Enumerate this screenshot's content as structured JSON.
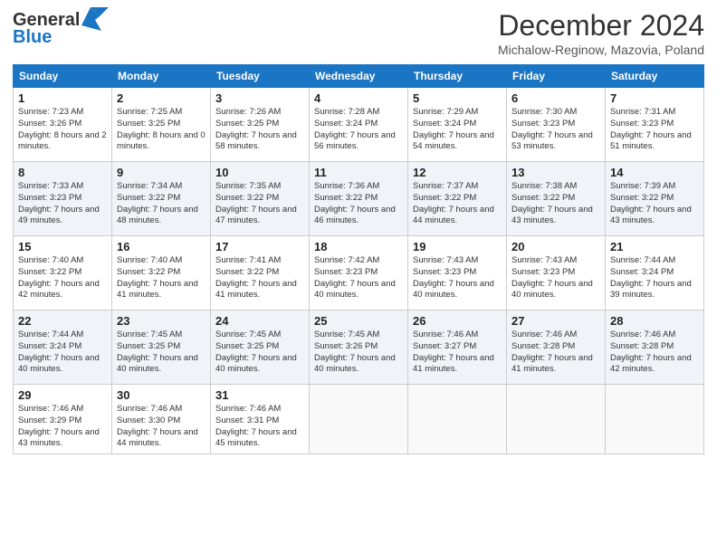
{
  "header": {
    "logo_general": "General",
    "logo_blue": "Blue",
    "title": "December 2024",
    "subtitle": "Michalow-Reginow, Mazovia, Poland"
  },
  "days_of_week": [
    "Sunday",
    "Monday",
    "Tuesday",
    "Wednesday",
    "Thursday",
    "Friday",
    "Saturday"
  ],
  "weeks": [
    [
      {
        "day": 1,
        "rise": "7:23 AM",
        "set": "3:26 PM",
        "daylight": "8 hours and 2 minutes"
      },
      {
        "day": 2,
        "rise": "7:25 AM",
        "set": "3:25 PM",
        "daylight": "8 hours and 0 minutes"
      },
      {
        "day": 3,
        "rise": "7:26 AM",
        "set": "3:25 PM",
        "daylight": "7 hours and 58 minutes"
      },
      {
        "day": 4,
        "rise": "7:28 AM",
        "set": "3:24 PM",
        "daylight": "7 hours and 56 minutes"
      },
      {
        "day": 5,
        "rise": "7:29 AM",
        "set": "3:24 PM",
        "daylight": "7 hours and 54 minutes"
      },
      {
        "day": 6,
        "rise": "7:30 AM",
        "set": "3:23 PM",
        "daylight": "7 hours and 53 minutes"
      },
      {
        "day": 7,
        "rise": "7:31 AM",
        "set": "3:23 PM",
        "daylight": "7 hours and 51 minutes"
      }
    ],
    [
      {
        "day": 8,
        "rise": "7:33 AM",
        "set": "3:23 PM",
        "daylight": "7 hours and 49 minutes"
      },
      {
        "day": 9,
        "rise": "7:34 AM",
        "set": "3:22 PM",
        "daylight": "7 hours and 48 minutes"
      },
      {
        "day": 10,
        "rise": "7:35 AM",
        "set": "3:22 PM",
        "daylight": "7 hours and 47 minutes"
      },
      {
        "day": 11,
        "rise": "7:36 AM",
        "set": "3:22 PM",
        "daylight": "7 hours and 46 minutes"
      },
      {
        "day": 12,
        "rise": "7:37 AM",
        "set": "3:22 PM",
        "daylight": "7 hours and 44 minutes"
      },
      {
        "day": 13,
        "rise": "7:38 AM",
        "set": "3:22 PM",
        "daylight": "7 hours and 43 minutes"
      },
      {
        "day": 14,
        "rise": "7:39 AM",
        "set": "3:22 PM",
        "daylight": "7 hours and 43 minutes"
      }
    ],
    [
      {
        "day": 15,
        "rise": "7:40 AM",
        "set": "3:22 PM",
        "daylight": "7 hours and 42 minutes"
      },
      {
        "day": 16,
        "rise": "7:40 AM",
        "set": "3:22 PM",
        "daylight": "7 hours and 41 minutes"
      },
      {
        "day": 17,
        "rise": "7:41 AM",
        "set": "3:22 PM",
        "daylight": "7 hours and 41 minutes"
      },
      {
        "day": 18,
        "rise": "7:42 AM",
        "set": "3:23 PM",
        "daylight": "7 hours and 40 minutes"
      },
      {
        "day": 19,
        "rise": "7:43 AM",
        "set": "3:23 PM",
        "daylight": "7 hours and 40 minutes"
      },
      {
        "day": 20,
        "rise": "7:43 AM",
        "set": "3:23 PM",
        "daylight": "7 hours and 40 minutes"
      },
      {
        "day": 21,
        "rise": "7:44 AM",
        "set": "3:24 PM",
        "daylight": "7 hours and 39 minutes"
      }
    ],
    [
      {
        "day": 22,
        "rise": "7:44 AM",
        "set": "3:24 PM",
        "daylight": "7 hours and 40 minutes"
      },
      {
        "day": 23,
        "rise": "7:45 AM",
        "set": "3:25 PM",
        "daylight": "7 hours and 40 minutes"
      },
      {
        "day": 24,
        "rise": "7:45 AM",
        "set": "3:25 PM",
        "daylight": "7 hours and 40 minutes"
      },
      {
        "day": 25,
        "rise": "7:45 AM",
        "set": "3:26 PM",
        "daylight": "7 hours and 40 minutes"
      },
      {
        "day": 26,
        "rise": "7:46 AM",
        "set": "3:27 PM",
        "daylight": "7 hours and 41 minutes"
      },
      {
        "day": 27,
        "rise": "7:46 AM",
        "set": "3:28 PM",
        "daylight": "7 hours and 41 minutes"
      },
      {
        "day": 28,
        "rise": "7:46 AM",
        "set": "3:28 PM",
        "daylight": "7 hours and 42 minutes"
      }
    ],
    [
      {
        "day": 29,
        "rise": "7:46 AM",
        "set": "3:29 PM",
        "daylight": "7 hours and 43 minutes"
      },
      {
        "day": 30,
        "rise": "7:46 AM",
        "set": "3:30 PM",
        "daylight": "7 hours and 44 minutes"
      },
      {
        "day": 31,
        "rise": "7:46 AM",
        "set": "3:31 PM",
        "daylight": "7 hours and 45 minutes"
      },
      null,
      null,
      null,
      null
    ]
  ]
}
